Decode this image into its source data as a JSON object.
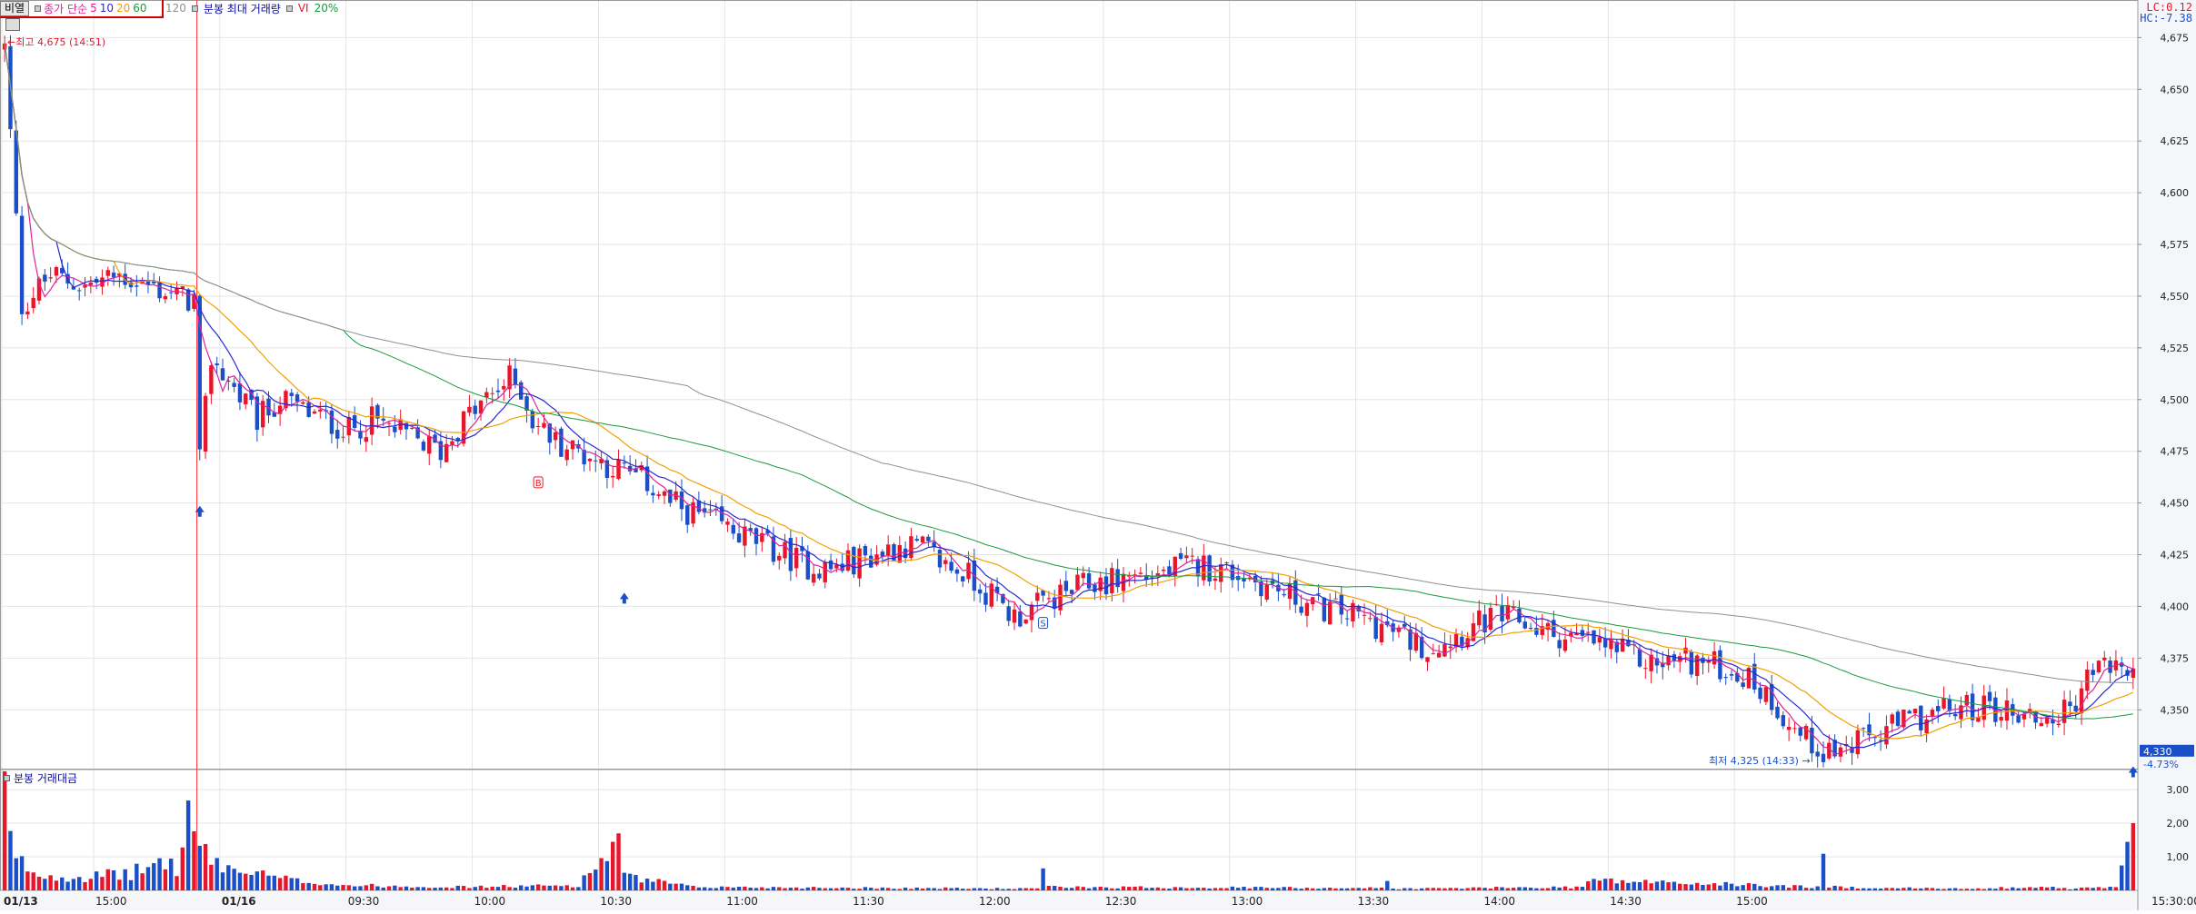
{
  "toolbar": {
    "mode_button": "비열",
    "ma_label": "종가 단순",
    "ma_periods": [
      "5",
      "10",
      "20",
      "60",
      "120"
    ],
    "ma_colors": [
      "#e0229a",
      "#2828d0",
      "#f0a000",
      "#1a9a3c",
      "#909090"
    ],
    "vol_label": "분봉 최대 거래량",
    "vi_label": "VI",
    "vi_pct": "20%"
  },
  "corner": {
    "lc": "LC:0.12",
    "hc": "HC:-7.38"
  },
  "volume_panel": {
    "title": "분봉 거래대금"
  },
  "colors": {
    "up": "#e8162b",
    "down": "#1a4fc8",
    "grid": "#e4e4e4",
    "axis_bg": "#f4f6fa",
    "session_divider": "#ff3030",
    "price_tag_bg": "#1a4fc8"
  },
  "chart_data": {
    "type": "candlestick",
    "price_axis": {
      "ylim": [
        4322,
        4680
      ],
      "ticks": [
        "4,675",
        "4,650",
        "4,625",
        "4,600",
        "4,575",
        "4,550",
        "4,525",
        "4,500",
        "4,475",
        "4,450",
        "4,425",
        "4,400",
        "4,375",
        "4,350"
      ]
    },
    "volume_axis": {
      "ylim": [
        0,
        3.3
      ],
      "ticks": [
        "3,00",
        "2,00",
        "1,00"
      ]
    },
    "x_axis": {
      "labels": [
        "01/13",
        "15:00",
        "01/16",
        "09:30",
        "10:00",
        "10:30",
        "11:00",
        "11:30",
        "12:00",
        "12:30",
        "13:00",
        "13:30",
        "14:00",
        "14:30",
        "15:00",
        "15:30:00"
      ],
      "session_break_label": "01/16"
    },
    "price_path": [
      [
        0,
        4670
      ],
      [
        3,
        4545
      ],
      [
        8,
        4560
      ],
      [
        14,
        4555
      ],
      [
        20,
        4560
      ],
      [
        25,
        4555
      ],
      [
        30,
        4550
      ],
      [
        33,
        4548
      ],
      [
        34,
        4470
      ],
      [
        36,
        4520
      ],
      [
        40,
        4505
      ],
      [
        44,
        4490
      ],
      [
        48,
        4500
      ],
      [
        52,
        4495
      ],
      [
        56,
        4490
      ],
      [
        60,
        4485
      ],
      [
        64,
        4490
      ],
      [
        68,
        4485
      ],
      [
        72,
        4480
      ],
      [
        76,
        4475
      ],
      [
        80,
        4490
      ],
      [
        84,
        4500
      ],
      [
        88,
        4510
      ],
      [
        90,
        4505
      ],
      [
        92,
        4490
      ],
      [
        96,
        4480
      ],
      [
        100,
        4475
      ],
      [
        104,
        4470
      ],
      [
        108,
        4465
      ],
      [
        112,
        4460
      ],
      [
        116,
        4450
      ],
      [
        120,
        4445
      ],
      [
        124,
        4440
      ],
      [
        128,
        4435
      ],
      [
        132,
        4430
      ],
      [
        136,
        4425
      ],
      [
        140,
        4420
      ],
      [
        144,
        4418
      ],
      [
        148,
        4422
      ],
      [
        152,
        4425
      ],
      [
        156,
        4430
      ],
      [
        160,
        4428
      ],
      [
        164,
        4420
      ],
      [
        168,
        4415
      ],
      [
        172,
        4405
      ],
      [
        176,
        4395
      ],
      [
        180,
        4400
      ],
      [
        184,
        4405
      ],
      [
        188,
        4410
      ],
      [
        192,
        4412
      ],
      [
        196,
        4415
      ],
      [
        200,
        4415
      ],
      [
        204,
        4418
      ],
      [
        208,
        4420
      ],
      [
        212,
        4418
      ],
      [
        216,
        4415
      ],
      [
        220,
        4410
      ],
      [
        224,
        4405
      ],
      [
        228,
        4400
      ],
      [
        232,
        4398
      ],
      [
        236,
        4395
      ],
      [
        240,
        4390
      ],
      [
        244,
        4385
      ],
      [
        248,
        4380
      ],
      [
        252,
        4385
      ],
      [
        256,
        4390
      ],
      [
        260,
        4395
      ],
      [
        264,
        4393
      ],
      [
        268,
        4388
      ],
      [
        272,
        4385
      ],
      [
        276,
        4383
      ],
      [
        280,
        4380
      ],
      [
        284,
        4375
      ],
      [
        288,
        4372
      ],
      [
        292,
        4375
      ],
      [
        296,
        4373
      ],
      [
        300,
        4370
      ],
      [
        304,
        4365
      ],
      [
        308,
        4355
      ],
      [
        312,
        4340
      ],
      [
        316,
        4332
      ],
      [
        320,
        4330
      ],
      [
        324,
        4335
      ],
      [
        328,
        4340
      ],
      [
        332,
        4345
      ],
      [
        336,
        4348
      ],
      [
        340,
        4350
      ],
      [
        344,
        4352
      ],
      [
        348,
        4350
      ],
      [
        352,
        4348
      ],
      [
        356,
        4345
      ],
      [
        360,
        4350
      ],
      [
        364,
        4370
      ],
      [
        368,
        4372
      ],
      [
        371,
        4365
      ]
    ],
    "volume_path": [
      [
        0,
        3.1
      ],
      [
        1,
        1.4
      ],
      [
        2,
        0.9
      ],
      [
        3,
        0.8
      ],
      [
        6,
        0.45
      ],
      [
        14,
        0.4
      ],
      [
        22,
        0.5
      ],
      [
        28,
        0.9
      ],
      [
        30,
        0.6
      ],
      [
        32,
        2.2
      ],
      [
        33,
        1.8
      ],
      [
        34,
        1.5
      ],
      [
        35,
        1.0
      ],
      [
        40,
        0.6
      ],
      [
        50,
        0.3
      ],
      [
        60,
        0.15
      ],
      [
        80,
        0.1
      ],
      [
        100,
        0.15
      ],
      [
        107,
        1.5
      ],
      [
        108,
        0.4
      ],
      [
        120,
        0.1
      ],
      [
        180,
        0.05
      ],
      [
        181,
        0.8
      ],
      [
        182,
        0.1
      ],
      [
        240,
        0.07
      ],
      [
        241,
        0.3
      ],
      [
        242,
        0.05
      ],
      [
        275,
        0.1
      ],
      [
        276,
        0.3
      ],
      [
        316,
        0.1
      ],
      [
        317,
        0.9
      ],
      [
        318,
        0.1
      ],
      [
        340,
        0.05
      ],
      [
        355,
        0.1
      ],
      [
        360,
        0.05
      ],
      [
        368,
        0.1
      ],
      [
        371,
        1.6
      ]
    ],
    "moving_averages": [
      {
        "period": 5,
        "color": "#e0229a",
        "label": "5"
      },
      {
        "period": 10,
        "color": "#2828d0",
        "label": "10"
      },
      {
        "period": 20,
        "color": "#f0a000",
        "label": "20"
      },
      {
        "period": 60,
        "color": "#1a9a3c",
        "label": "60"
      },
      {
        "period": 120,
        "color": "#909090",
        "label": "120"
      }
    ],
    "annotations": {
      "high": "최고 4,675 (14:51)",
      "low": "최저 4,325 (14:33)",
      "last_price": "4,330",
      "last_change": "-4.73%",
      "markers": [
        {
          "type": "buy-arrow",
          "x": 34,
          "y": 4446
        },
        {
          "type": "buy-arrow",
          "x": 108,
          "y": 4404
        },
        {
          "type": "signal-B",
          "x": 93,
          "y": 4460
        },
        {
          "type": "signal-S",
          "x": 181,
          "y": 4392
        },
        {
          "type": "buy-arrow",
          "x": 371,
          "y": 4320
        }
      ]
    }
  }
}
